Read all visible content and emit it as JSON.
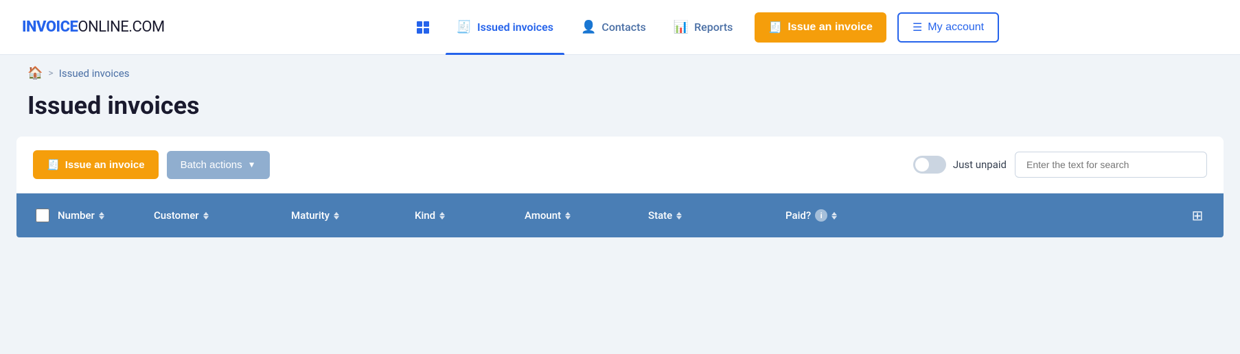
{
  "brand": {
    "name_part1": "INVOICE",
    "name_part2": "ONLINE.COM"
  },
  "nav": {
    "dashboard_icon": "⊞",
    "issued_invoices_label": "Issued invoices",
    "contacts_icon": "👤",
    "contacts_label": "Contacts",
    "reports_icon": "📊",
    "reports_label": "Reports",
    "issue_invoice_icon": "🧾",
    "issue_invoice_label": "Issue an invoice",
    "my_account_icon": "☰",
    "my_account_label": "My account"
  },
  "breadcrumb": {
    "home_icon": "🏠",
    "separator": ">",
    "current": "Issued invoices"
  },
  "page": {
    "title": "Issued invoices"
  },
  "toolbar": {
    "issue_button_label": "Issue an invoice",
    "batch_button_label": "Batch actions",
    "toggle_label": "Just unpaid",
    "search_placeholder": "Enter the text for search"
  },
  "table": {
    "columns": [
      {
        "id": "number",
        "label": "Number",
        "sortable": true
      },
      {
        "id": "customer",
        "label": "Customer",
        "sortable": true
      },
      {
        "id": "maturity",
        "label": "Maturity",
        "sortable": true
      },
      {
        "id": "kind",
        "label": "Kind",
        "sortable": true
      },
      {
        "id": "amount",
        "label": "Amount",
        "sortable": true
      },
      {
        "id": "state",
        "label": "State",
        "sortable": true
      },
      {
        "id": "paid",
        "label": "Paid?",
        "sortable": true,
        "info": true
      }
    ]
  }
}
